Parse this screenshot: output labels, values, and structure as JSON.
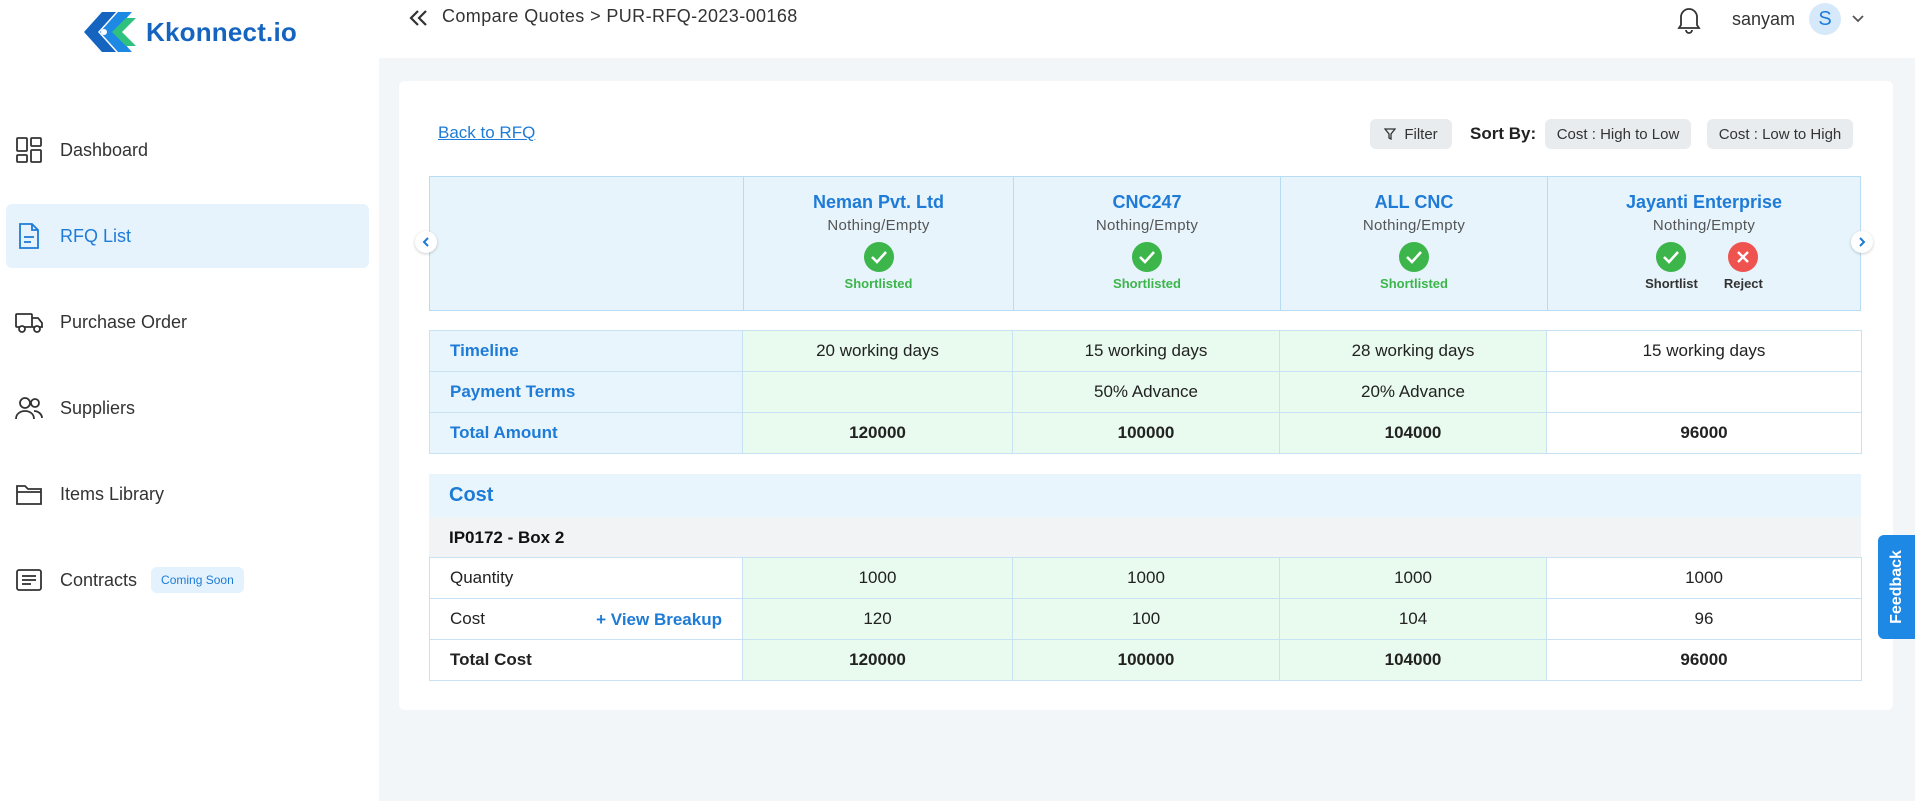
{
  "brand": {
    "name": "Kkonnect.io"
  },
  "sidebar": {
    "items": [
      {
        "label": "Dashboard",
        "icon": "dashboard-icon",
        "active": false
      },
      {
        "label": "RFQ List",
        "icon": "document-icon",
        "active": true
      },
      {
        "label": "Purchase Order",
        "icon": "truck-icon",
        "active": false
      },
      {
        "label": "Suppliers",
        "icon": "users-icon",
        "active": false
      },
      {
        "label": "Items Library",
        "icon": "folder-icon",
        "active": false
      },
      {
        "label": "Contracts",
        "icon": "list-icon",
        "active": false,
        "badge": "Coming Soon"
      }
    ]
  },
  "header": {
    "breadcrumb": "Compare Quotes > PUR-RFQ-2023-00168",
    "user_name": "sanyam",
    "avatar_initial": "S"
  },
  "toolbar": {
    "back_label": "Back to RFQ",
    "filter_label": "Filter",
    "sort_label": "Sort By:",
    "sort_options": [
      "Cost : High to Low",
      "Cost : Low to High"
    ]
  },
  "vendors": [
    {
      "name": "Neman Pvt. Ltd",
      "sub": "Nothing/Empty",
      "status": "Shortlisted"
    },
    {
      "name": "CNC247",
      "sub": "Nothing/Empty",
      "status": "Shortlisted"
    },
    {
      "name": "ALL CNC",
      "sub": "Nothing/Empty",
      "status": "Shortlisted"
    },
    {
      "name": "Jayanti Enterprise",
      "sub": "Nothing/Empty",
      "shortlist_label": "Shortlist",
      "reject_label": "Reject"
    }
  ],
  "summary": {
    "rows": [
      {
        "label": "Timeline",
        "values": [
          "20 working days",
          "15 working days",
          "28 working days",
          "15 working days"
        ]
      },
      {
        "label": "Payment Terms",
        "values": [
          "",
          "50% Advance",
          "20% Advance",
          ""
        ]
      },
      {
        "label": "Total Amount",
        "values": [
          "120000",
          "100000",
          "104000",
          "96000"
        ]
      }
    ]
  },
  "cost": {
    "title": "Cost",
    "item": "IP0172 - Box 2",
    "view_breakup": "+ View Breakup",
    "rows": [
      {
        "label": "Quantity",
        "values": [
          "1000",
          "1000",
          "1000",
          "1000"
        ]
      },
      {
        "label": "Cost",
        "values": [
          "120",
          "100",
          "104",
          "96"
        ]
      },
      {
        "label": "Total Cost",
        "values": [
          "120000",
          "100000",
          "104000",
          "96000"
        ]
      }
    ]
  },
  "feedback_label": "Feedback",
  "colors": {
    "accent": "#1e7bd6",
    "shortlisted": "#3cb54a",
    "reject": "#ef5350",
    "highlight_green": "#e8fbee",
    "header_blue": "#e7f4fc"
  }
}
